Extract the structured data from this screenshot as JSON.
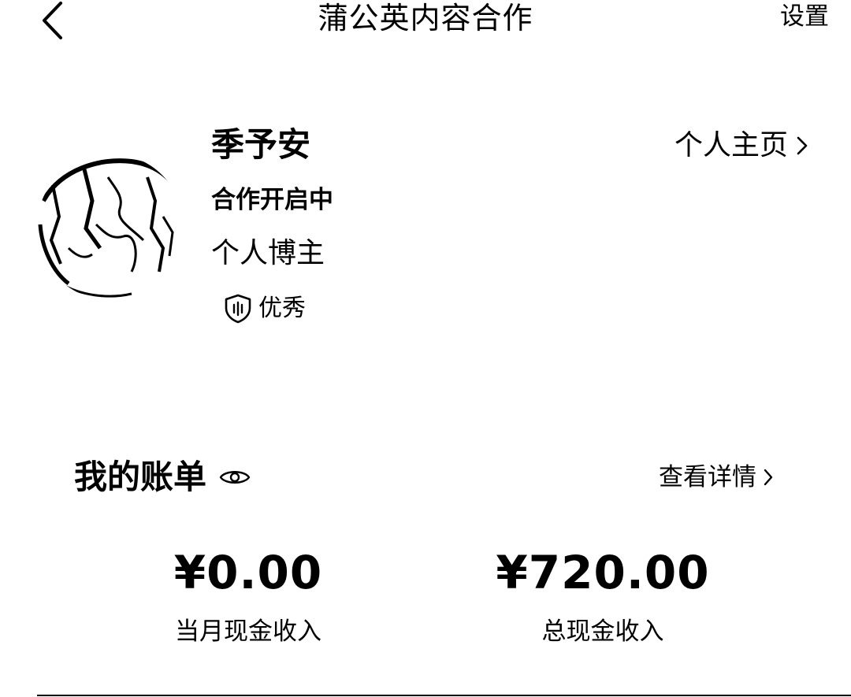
{
  "nav": {
    "title": "蒲公英内容合作",
    "settings_label": "设置",
    "back_icon": "chevron-left-icon"
  },
  "profile": {
    "name": "季予安",
    "homepage_link": "个人主页",
    "status": "合作开启中",
    "role": "个人博主",
    "badge_label": "优秀",
    "badge_icon": "shield-icon"
  },
  "bill": {
    "title": "我的账单",
    "visibility_icon": "eye-icon",
    "detail_link": "查看详情",
    "stats": [
      {
        "value": "¥0.00",
        "label": "当月现金收入"
      },
      {
        "value": "¥720.00",
        "label": "总现金收入"
      }
    ]
  },
  "colors": {
    "text": "#000000",
    "background": "#ffffff"
  }
}
